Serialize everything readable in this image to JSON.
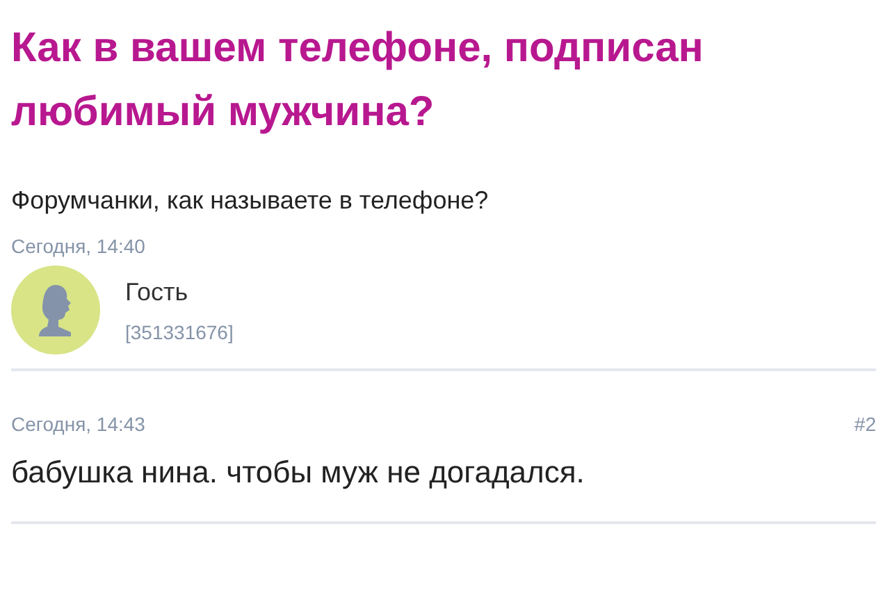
{
  "topic": {
    "title": "Как в вашем телефоне, подписан любимый мужчина?",
    "body": "Форумчанки, как называете в телефоне?",
    "time": "Сегодня, 14:40",
    "author": {
      "name": "Гость",
      "id": "[351331676]"
    }
  },
  "replies": [
    {
      "time": "Сегодня, 14:43",
      "number": "#2",
      "text": "бабушка нина. чтобы муж не догадался."
    }
  ]
}
